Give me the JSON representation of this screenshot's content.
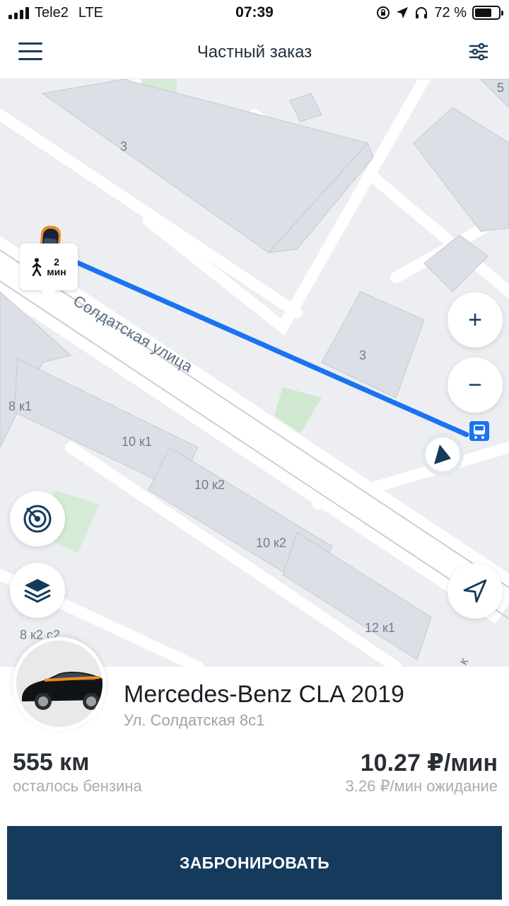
{
  "status_bar": {
    "carrier": "Tele2",
    "network": "LTE",
    "time": "07:39",
    "battery": "72 %",
    "battery_level": 0.72
  },
  "header": {
    "title": "Частный заказ",
    "menu_icon": "hamburger-menu-icon",
    "filter_icon": "sliders-icon"
  },
  "map": {
    "street_name": "Солдатская улица",
    "building_labels": [
      "3",
      "3",
      "5",
      "8 к1",
      "10 к1",
      "10 к2",
      "10 к2",
      "12 к1",
      "8 к2 с2",
      "к"
    ],
    "walk_time": {
      "value": "2",
      "unit": "мин",
      "icon": "walking-person-icon"
    },
    "controls": {
      "zoom_in": "+",
      "zoom_out": "−"
    },
    "colors": {
      "route": "#1a73f0",
      "accent_dark": "#163a5c",
      "car_orange": "#f08a1c"
    }
  },
  "car": {
    "name": "Mercedes-Benz CLA 2019",
    "address": "Ул. Солдатская 8с1",
    "fuel_value": "555 км",
    "fuel_label": "осталось бензина",
    "price": "10.27 ₽/мин",
    "waiting_price": "3.26 ₽/мин ожидание"
  },
  "actions": {
    "book_label": "ЗАБРОНИРОВАТЬ"
  }
}
